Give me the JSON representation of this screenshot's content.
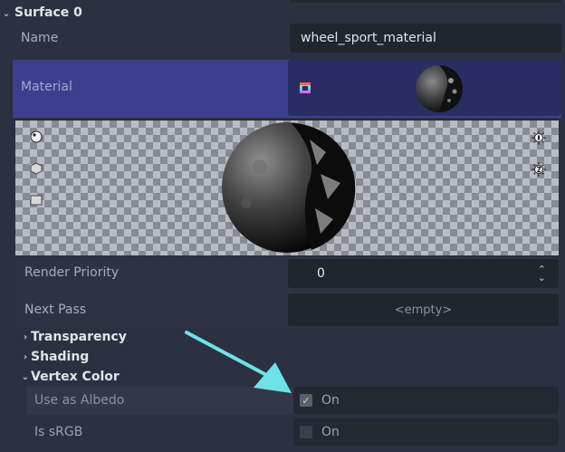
{
  "surface": {
    "title": "Surface 0",
    "name_label": "Name",
    "name_value": "wheel_sport_material",
    "material_label": "Material"
  },
  "preview_toolbar": {
    "left_icons": [
      "sphere-preview-icon",
      "cube-preview-icon",
      "plane-preview-icon"
    ],
    "right_icons": [
      "light-1-icon",
      "light-2-icon"
    ]
  },
  "properties": {
    "render_priority_label": "Render Priority",
    "render_priority_value": "0",
    "next_pass_label": "Next Pass",
    "next_pass_value": "<empty>"
  },
  "groups": {
    "transparency": "Transparency",
    "shading": "Shading",
    "vertex_color": "Vertex Color"
  },
  "vertex_color": {
    "use_as_albedo_label": "Use as Albedo",
    "use_as_albedo_value": "On",
    "use_as_albedo_checked": true,
    "is_srgb_label": "Is sRGB",
    "is_srgb_value": "On",
    "is_srgb_checked": false
  },
  "colors": {
    "material_row": "#3d3f8e",
    "arrow": "#6de3e8"
  }
}
